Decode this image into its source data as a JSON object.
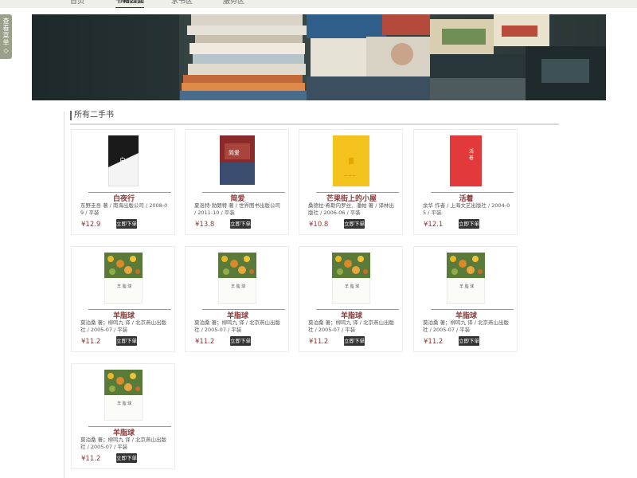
{
  "nav": {
    "items": [
      {
        "label": "首页"
      },
      {
        "label": "书籍园面",
        "active": true
      },
      {
        "label": "求书区"
      },
      {
        "label": "服务区"
      }
    ]
  },
  "side_menu": {
    "label": "查看菜单",
    "icon": "arrow-icon"
  },
  "section": {
    "title": "所有二手书"
  },
  "order_label": "立即下单",
  "books": [
    {
      "title": "白夜行",
      "meta": "东野圭吾 著 / 南海出版公司 / 2008-09 / 平装",
      "price": "¥12.9",
      "cover": "black-white"
    },
    {
      "title": "简爱",
      "meta": "夏洛特·勃朗特 著 / 世界图书出版公司 / 2011-10 / 平装",
      "price": "¥13.8",
      "cover": "red-blue"
    },
    {
      "title": "芒果街上的小屋",
      "meta": "桑德拉·希斯内罗丝、潘帕 著 / 译林出版社 / 2006-06 / 平装",
      "price": "¥10.8",
      "cover": "yellow"
    },
    {
      "title": "活着",
      "meta": "余华 作者 / 上海文艺出版社 / 2004-05 / 平装",
      "price": "¥12.1",
      "cover": "red"
    },
    {
      "title": "羊脂球",
      "meta": "莫泊桑 著；柳鸣九 译 / 北京燕山出版社 / 2005-07 / 平装",
      "price": "¥11.2",
      "cover": "flowers"
    },
    {
      "title": "羊脂球",
      "meta": "莫泊桑 著；柳鸣九 译 / 北京燕山出版社 / 2005-07 / 平装",
      "price": "¥11.2",
      "cover": "flowers"
    },
    {
      "title": "羊脂球",
      "meta": "莫泊桑 著；柳鸣九 译 / 北京燕山出版社 / 2005-07 / 平装",
      "price": "¥11.2",
      "cover": "flowers"
    },
    {
      "title": "羊脂球",
      "meta": "莫泊桑 著；柳鸣九 译 / 北京燕山出版社 / 2005-07 / 平装",
      "price": "¥11.2",
      "cover": "flowers"
    },
    {
      "title": "羊脂球",
      "meta": "莫泊桑 著；柳鸣九 译 / 北京燕山出版社 / 2005-07 / 平装",
      "price": "¥11.2",
      "cover": "flowers"
    }
  ],
  "colors": {
    "accent": "#8b3a3a",
    "button": "#333333",
    "side_menu": "#9aa08a"
  }
}
